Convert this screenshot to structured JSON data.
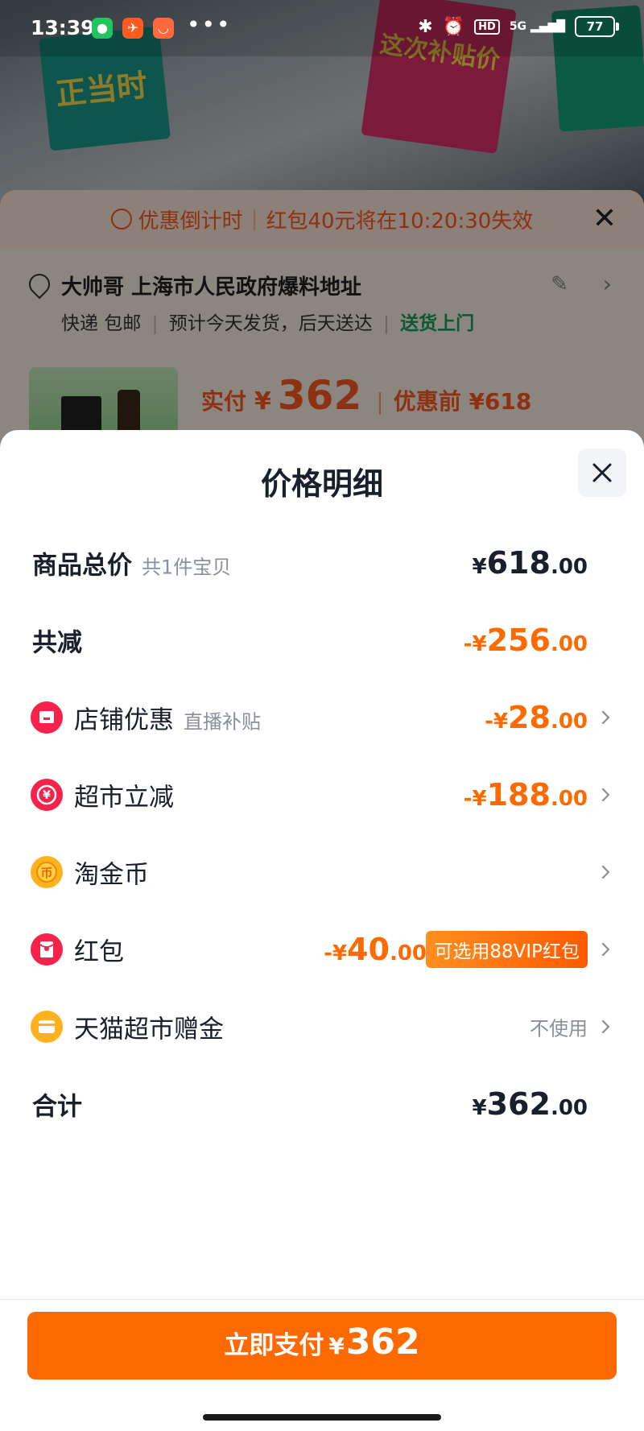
{
  "status_bar": {
    "time": "13:39",
    "dots": "•••",
    "signal": "5G",
    "hd": "HD",
    "battery": "77"
  },
  "background": {
    "banner_left_text": "正当时",
    "banner_mid_text": "这次补贴价",
    "countdown_label": "优惠倒计时",
    "countdown_text": "红包40元将在10:20:30失效",
    "address_name": "大帅哥 上海市人民政府爆料地址",
    "delivery_left": "快递 包邮",
    "delivery_mid": "预计今天发货，后天送达",
    "delivery_door": "送货上门",
    "paid_label": "实付",
    "paid_currency": "¥",
    "paid_amount": "362",
    "pre_discount": "优惠前 ¥618"
  },
  "sheet": {
    "title": "价格明细",
    "close_icon": "close-icon",
    "rows": {
      "subtotal": {
        "label": "商品总价",
        "sub": "共1件宝贝",
        "cur": "¥",
        "int": "618",
        "dec": ".00"
      },
      "discount_total": {
        "label": "共减",
        "cur": "-¥",
        "int": "256",
        "dec": ".00"
      },
      "shop_discount": {
        "label": "店铺优惠",
        "sub": "直播补贴",
        "cur": "-¥",
        "int": "28",
        "dec": ".00",
        "icon": "shop-icon"
      },
      "market_discount": {
        "label": "超市立减",
        "cur": "-¥",
        "int": "188",
        "dec": ".00",
        "icon": "yuan-coin-icon"
      },
      "taojin_coin": {
        "label": "淘金币",
        "icon": "coin-icon"
      },
      "red_packet": {
        "label": "红包",
        "cur": "-¥",
        "int": "40",
        "dec": ".00",
        "badge": "可选用88VIP红包",
        "icon": "red-packet-icon"
      },
      "gift_money": {
        "label": "天猫超市赠金",
        "muted": "不使用",
        "icon": "wallet-icon"
      },
      "total": {
        "label": "合计",
        "cur": "¥",
        "int": "362",
        "dec": ".00"
      }
    }
  },
  "footer": {
    "pay_label": "立即支付",
    "pay_currency": "¥",
    "pay_amount": "362"
  },
  "colors": {
    "accent": "#ff6a00",
    "text": "#1a1f2c",
    "muted": "#8a8f99",
    "green": "#17a05b"
  }
}
